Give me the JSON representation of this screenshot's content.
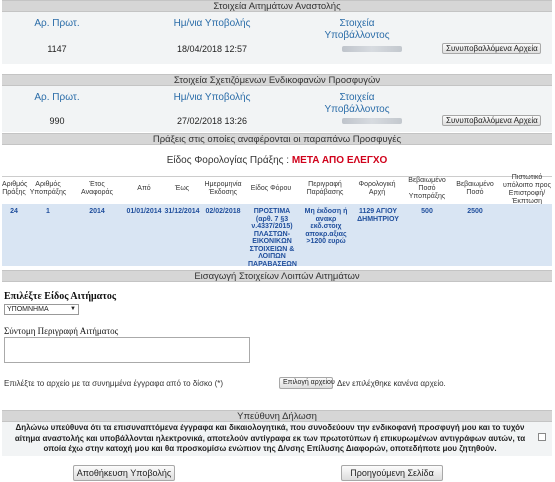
{
  "section1": {
    "title": "Στοιχεία Αιτημάτων Αναστολής",
    "headers": {
      "ar_prot": "Αρ. Πρωτ.",
      "date": "Ημ/νια Υποβολής",
      "submitter": "Στοιχεία Υποβάλλοντος"
    },
    "row": {
      "ar_prot": "1147",
      "date": "18/04/2018 12:57",
      "button": "Συνυποβαλλόμενα Αρχεία"
    }
  },
  "section2": {
    "title": "Στοιχεία Σχετιζόμενων Ενδικοφανών Προσφυγών",
    "headers": {
      "ar_prot": "Αρ. Πρωτ.",
      "date": "Ημ/νια Υποβολής",
      "submitter": "Στοιχεία Υποβάλλοντος"
    },
    "row": {
      "ar_prot": "990",
      "date": "27/02/2018 13:26",
      "button": "Συνυποβαλλόμενα Αρχεία"
    }
  },
  "section3": {
    "title": "Πράξεις στις οποίες αναφέρονται οι παραπάνω Προσφυγές",
    "kind_label": "Είδος Φορολογίας Πράξης :",
    "kind_value": "ΜΕΤΑ ΑΠΟ ΕΛΕΓΧΟ",
    "columns": [
      "Αριθμός Πράξης",
      "Αριθμός Υποπράξης",
      "Έτος Αναφοράς",
      "Από",
      "Έως",
      "Ημερομηνία Έκδοσης",
      "Είδος Φόρου",
      "Περιγραφή Παράβασης",
      "Φορολογική Αρχή",
      "Βεβαιωμένο Ποσό Υποπράξης",
      "Βεβαιωμένο Ποσό",
      "Πιστωτικό υπόλοιπο προς Επιστροφή/ Έκπτωση"
    ],
    "row": [
      "24",
      "1",
      "2014",
      "01/01/2014",
      "31/12/2014",
      "02/02/2018",
      "ΠΡΟΣΤΙΜΑ (αρθ. 7 §3 ν.4337/2015) ΠΛΑΣΤΩΝ-ΕΙΚΟΝΙΚΩΝ ΣΤΟΙΧΕΙΩΝ & ΛΟΙΠΩΝ ΠΑΡΑΒΑΣΕΩΝ",
      "Μη έκδοση ή ανακρ εκδ.στοιχ αποκρ.αξιας >1200 ευρώ",
      "1129 ΑΓΙΟΥ ΔΗΜΗΤΡΙΟΥ",
      "500",
      "2500",
      ""
    ]
  },
  "section4": {
    "title": "Εισαγωγή Στοιχείων Λοιπών Αιτημάτων",
    "type_label": "Επιλέξτε Είδος Αιτήματος",
    "type_value": "ΥΠΟΜΝΗΜΑ",
    "desc_label": "Σύντομη Περιγραφή Αιτήματος",
    "file_label": "Επιλέξτε το αρχείο με τα συνημμένα έγγραφα από το δίσκο (*)",
    "file_button": "Επιλογή αρχείου",
    "file_status": "Δεν επιλέχθηκε κανένα αρχείο."
  },
  "section5": {
    "title": "Υπεύθυνη Δήλωση",
    "declaration": "Δηλώνω υπεύθυνα ότι τα επισυναπτόμενα έγγραφα και δικαιολογητικά, που συνοδεύουν την ενδικοφανή προσφυγή μου και το τυχόν αίτημα αναστολής και υποβάλλονται ηλεκτρονικά, αποτελούν αντίγραφα εκ των πρωτοτύπων ή επικυρωμένων αντιγράφων αυτών, τα οποία έχω στην κατοχή μου και θα προσκομίσω ενώπιον της Δ/νσης Επίλυσης Διαφορών, οποτεδήποτε μου ζητηθούν.",
    "save_button": "Αποθήκευση Υποβολής",
    "prev_button": "Προηγούμενη Σελίδα"
  },
  "colors": {
    "header_blue": "#2a6ca8",
    "row_blue": "#d9e5f3",
    "accent_red": "#d0021b"
  }
}
